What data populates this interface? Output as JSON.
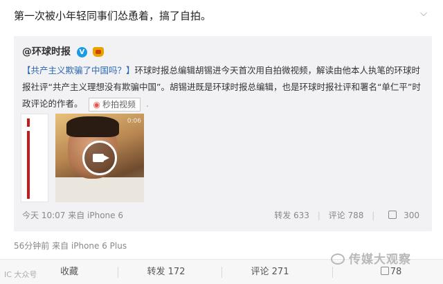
{
  "post": {
    "text": "第一次被小年轻同事们怂恿着，搞了自拍。",
    "menu_icon": "chevron-down-icon"
  },
  "repost": {
    "author": "@环球时报",
    "verified_badge": "V",
    "body_link": "【共产主义欺骗了中国吗？】",
    "body": "环球时报总编辑胡锡进今天首次用自拍微视频，解读由他本人执笔的环球时报社评“共产主义理想没有欺骗中国”。胡锡进既是环球时报总编辑，也是环球时报社评和署名“单仁平”时政评论的作者。",
    "video_button": "秒拍视频",
    "video_corner": "0:06",
    "time": "今天 10:07 来自 iPhone 6",
    "repost_label": "转发 633",
    "comment_label": "评论 788",
    "like_label": "300"
  },
  "outer": {
    "time": "56分钟前 来自 iPhone 6 Plus",
    "collect_label": "收藏",
    "repost_label": "转发 172",
    "comment_label": "评论 271",
    "like_label": "78"
  },
  "watermarks": {
    "left": "IC 大众号",
    "right": "传媒大观察"
  },
  "colors": {
    "link": "#2a68b1",
    "verified": "#1a9be6",
    "repost_bg": "#f2f2f5"
  }
}
